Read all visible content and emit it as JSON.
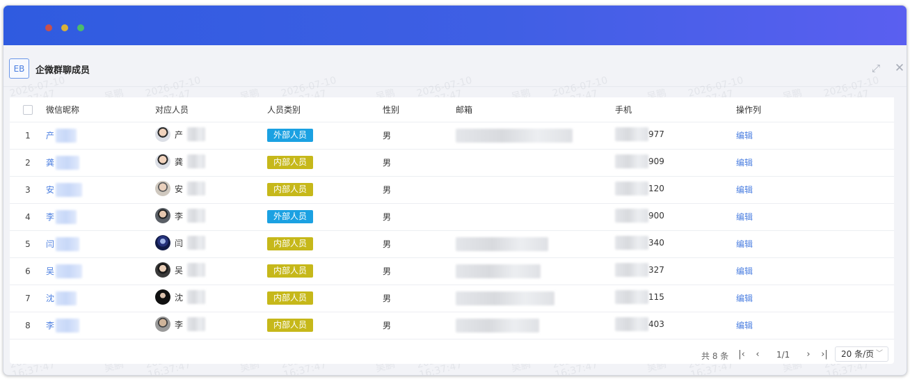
{
  "dialog": {
    "badge": "EB",
    "title": "企微群聊成员"
  },
  "table": {
    "columns": [
      "微信昵称",
      "对应人员",
      "人员类别",
      "性别",
      "邮箱",
      "手机",
      "操作列"
    ],
    "rows": [
      {
        "index": "1",
        "nick": "产",
        "person": "产",
        "category": "外部人员",
        "category_type": "external",
        "gender": "男",
        "phone_tail": "977",
        "action": "编辑"
      },
      {
        "index": "2",
        "nick": "龚",
        "person": "龚",
        "category": "内部人员",
        "category_type": "internal",
        "gender": "男",
        "phone_tail": "909",
        "action": "编辑"
      },
      {
        "index": "3",
        "nick": "安",
        "person": "安",
        "category": "内部人员",
        "category_type": "internal",
        "gender": "男",
        "phone_tail": "120",
        "action": "编辑"
      },
      {
        "index": "4",
        "nick": "李",
        "person": "李",
        "category": "外部人员",
        "category_type": "external",
        "gender": "男",
        "phone_tail": "900",
        "action": "编辑"
      },
      {
        "index": "5",
        "nick": "闫",
        "person": "闫",
        "category": "内部人员",
        "category_type": "internal",
        "gender": "男",
        "phone_tail": "340",
        "action": "编辑"
      },
      {
        "index": "6",
        "nick": "吴",
        "person": "吴",
        "category": "内部人员",
        "category_type": "internal",
        "gender": "男",
        "phone_tail": "327",
        "action": "编辑"
      },
      {
        "index": "7",
        "nick": "沈",
        "person": "沈",
        "category": "内部人员",
        "category_type": "internal",
        "gender": "男",
        "phone_tail": "115",
        "action": "编辑"
      },
      {
        "index": "8",
        "nick": "李",
        "person": "李",
        "category": "内部人员",
        "category_type": "internal",
        "gender": "男",
        "phone_tail": "403",
        "action": "编辑"
      }
    ]
  },
  "pagination": {
    "total": "共 8 条",
    "page": "1/1",
    "page_size": "20 条/页"
  },
  "watermark": {
    "name": "吴鹏",
    "date": "2026-07-10",
    "time": "16:37:47"
  },
  "colors": {
    "external_tag": "#1ba1e2",
    "internal_tag": "#c6b81a",
    "link": "#4a7ee0",
    "titlebar": "#2f5be0"
  }
}
